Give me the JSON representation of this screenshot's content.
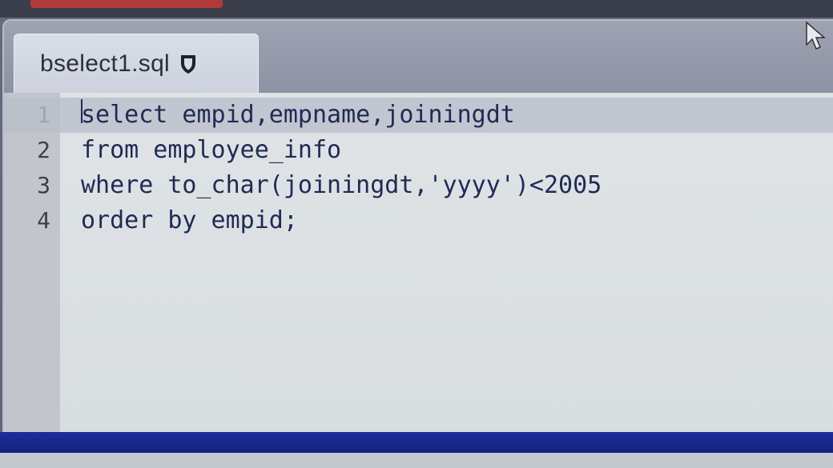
{
  "tab": {
    "filename": "bselect1.sql",
    "icon": "shield-icon"
  },
  "editor": {
    "lines": [
      {
        "number": "1",
        "text": "select empid,empname,joiningdt"
      },
      {
        "number": "2",
        "text": "from employee_info"
      },
      {
        "number": "3",
        "text": "where to_char(joiningdt,'yyyy')<2005"
      },
      {
        "number": "4",
        "text": "order by empid;"
      }
    ]
  },
  "colors": {
    "code_text": "#1f2a55",
    "status_bar": "#1d2e9a"
  }
}
